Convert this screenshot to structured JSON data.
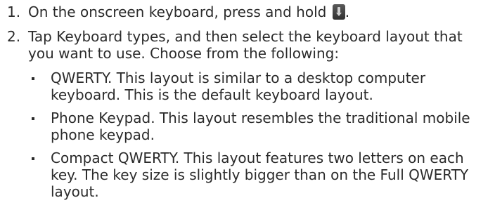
{
  "steps": [
    {
      "number": "1.",
      "text_before": "On the onscreen keyboard, press and hold",
      "text_after": ".",
      "icon": "keyboard-key-icon"
    },
    {
      "number": "2.",
      "line1_prefix": "Tap ",
      "line1_keyword": "Keyboard types",
      "line1_suffix": ", and then select the keyboard layout that",
      "line2": "you want to use. Choose from the following:"
    }
  ],
  "options": [
    {
      "name": "QWERTY",
      "line1_rest": ". This layout is similar to a desktop computer",
      "line2": "keyboard. This is the default keyboard layout."
    },
    {
      "name": "Phone Keypad",
      "line1_rest": ". This layout resembles the traditional mobile",
      "line2": "phone keypad."
    },
    {
      "name": "Compact QWERTY",
      "line1_rest": ". This layout features two letters on each",
      "line2": "key. The key size is slightly bigger than on the Full QWERTY",
      "line3": "layout."
    }
  ]
}
